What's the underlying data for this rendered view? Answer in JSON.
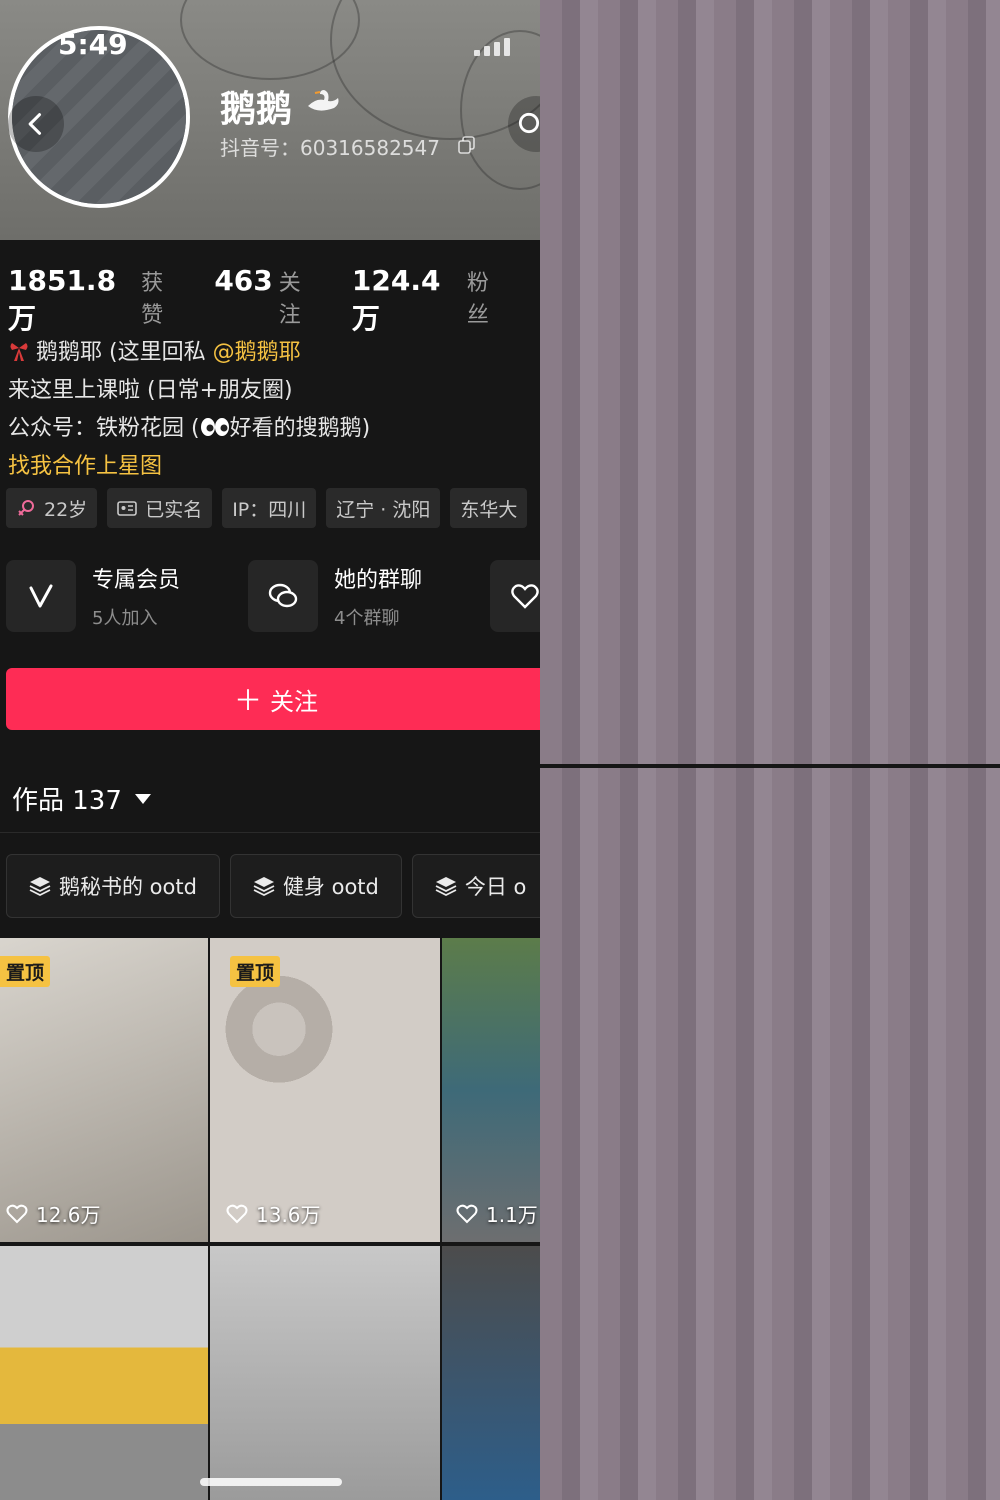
{
  "status_bar": {
    "time": "5:49"
  },
  "profile": {
    "nickname": "鹅鹅",
    "douyin_id": "抖音号：60316582547",
    "avatar": "anime-style avatar"
  },
  "stats": [
    {
      "value": "1851.8万",
      "label": "获赞"
    },
    {
      "value": "463",
      "label": "关注"
    },
    {
      "value": "124.4万",
      "label": "粉丝"
    }
  ],
  "bio": {
    "line1_prefix": "鹅鹅耶 (这里回私 ",
    "line1_mention": "@鹅鹅耶",
    "line2": "来这里上课啦 (日常+朋友圈)",
    "line3_prefix": "公众号：铁粉花园 (",
    "line3_suffix": "好看的搜鹅鹅)",
    "line4": "找我合作上星图"
  },
  "tags": [
    "22岁",
    "已实名",
    "IP：四川",
    "辽宁 · 沈阳",
    "东华大"
  ],
  "features": [
    {
      "title": "专属会员",
      "sub": "5人加入",
      "icon": "v-badge-icon"
    },
    {
      "title": "她的群聊",
      "sub": "4个群聊",
      "icon": "chat-bubbles-icon"
    },
    {
      "title": "",
      "sub": "",
      "icon": "heart-badge-icon"
    }
  ],
  "follow_button": {
    "plus": "＋",
    "label": "关注"
  },
  "works": {
    "label": "作品 137"
  },
  "collections": [
    "鹅秘书的 ootd",
    "健身 ootd",
    "今日 o"
  ],
  "videos": [
    {
      "pinned": "置顶",
      "likes": "12.6万"
    },
    {
      "pinned": "置顶",
      "likes": "13.6万"
    },
    {
      "pinned": "",
      "likes": "1.1万"
    },
    {
      "pinned": "",
      "likes": ""
    },
    {
      "pinned": "",
      "likes": ""
    },
    {
      "pinned": "",
      "likes": ""
    }
  ],
  "colors": {
    "accent_follow": "#fe2c55",
    "mention_yellow": "#f5c242",
    "pinned_badge": "#f5c242",
    "background": "#161616"
  }
}
